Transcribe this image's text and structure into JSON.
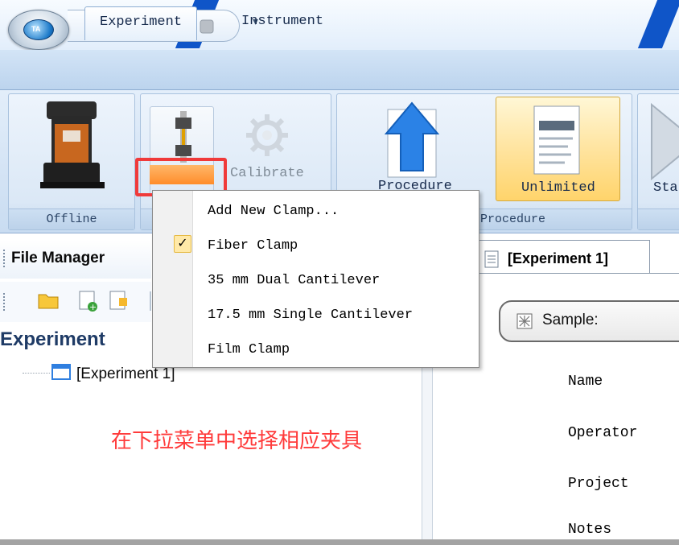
{
  "ribbon": {
    "tabs": [
      {
        "label": "Experiment",
        "active": true
      },
      {
        "label": "Instrument",
        "active": false
      }
    ],
    "buttons": {
      "calibrate": "Calibrate",
      "procedure": "Procedure",
      "unlimited": "Unlimited",
      "start": "Start"
    },
    "groups": {
      "offline": "Offline",
      "procedure": "Procedure"
    }
  },
  "clamp_menu": {
    "items": [
      {
        "label": "Add New Clamp...",
        "checked": false
      },
      {
        "label": "Fiber Clamp",
        "checked": true
      },
      {
        "label": "35 mm Dual Cantilever",
        "checked": false
      },
      {
        "label": "17.5 mm Single Cantilever",
        "checked": false
      },
      {
        "label": "Film Clamp",
        "checked": false
      }
    ],
    "check_mark": "✓"
  },
  "file_manager": {
    "title": "File Manager",
    "section": "Experiment",
    "tree": [
      {
        "label": "[Experiment 1]"
      }
    ]
  },
  "document": {
    "tab": "[Experiment 1]",
    "sample_label": "Sample:",
    "fields": [
      "Name",
      "Operator",
      "Project",
      "Notes"
    ]
  },
  "annotation": "在下拉菜单中选择相应夹具",
  "icons": [
    "save-icon",
    "procedure-icon",
    "play-icon",
    "stop-icon",
    "dropdown-arrow-icon",
    "folder-icon",
    "add-file-icon",
    "edit-file-icon"
  ],
  "colors": {
    "highlight": "#f03a3a",
    "annotation": "#ff3b3b",
    "ribbon": "#c9dcf1",
    "checked_item": "#ffe9a8"
  }
}
